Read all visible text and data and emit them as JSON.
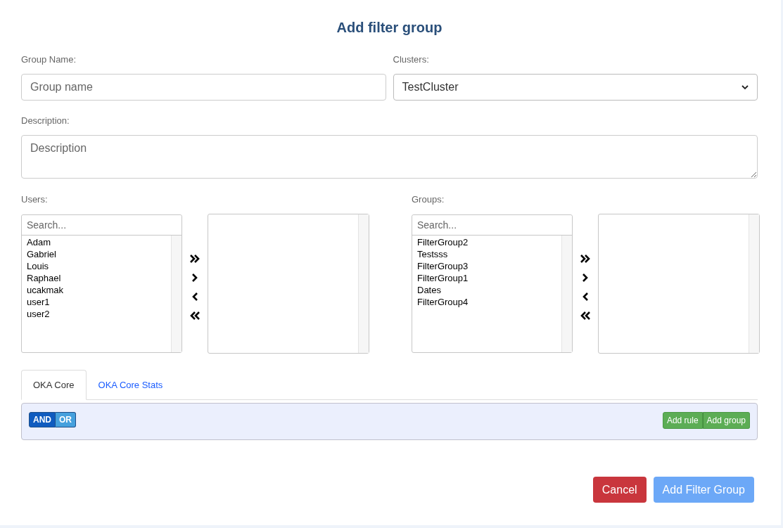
{
  "title": "Add filter group",
  "group_name": {
    "label": "Group Name:",
    "placeholder": "Group name"
  },
  "clusters": {
    "label": "Clusters:",
    "value": "TestCluster"
  },
  "description": {
    "label": "Description:",
    "placeholder": "Description"
  },
  "pickers": [
    {
      "label": "Users:",
      "search_placeholder": "Search...",
      "available": [
        "Adam",
        "Gabriel",
        "Louis",
        "Raphael",
        "ucakmak",
        "user1",
        "user2"
      ]
    },
    {
      "label": "Groups:",
      "search_placeholder": "Search...",
      "available": [
        "FilterGroup2",
        "Testsss",
        "FilterGroup3",
        "FilterGroup1",
        "Dates",
        "FilterGroup4"
      ]
    }
  ],
  "tabs": [
    {
      "label": "OKA Core",
      "selected": true
    },
    {
      "label": "OKA Core Stats",
      "selected": false
    }
  ],
  "query": {
    "conditions": [
      {
        "label": "AND",
        "selected": true
      },
      {
        "label": "OR",
        "selected": false
      }
    ],
    "actions": [
      "Add rule",
      "Add group"
    ]
  },
  "buttons": [
    {
      "label": "Cancel",
      "kind": "danger",
      "disabled": false
    },
    {
      "label": "Add Filter Group",
      "kind": "primary",
      "disabled": true
    }
  ]
}
